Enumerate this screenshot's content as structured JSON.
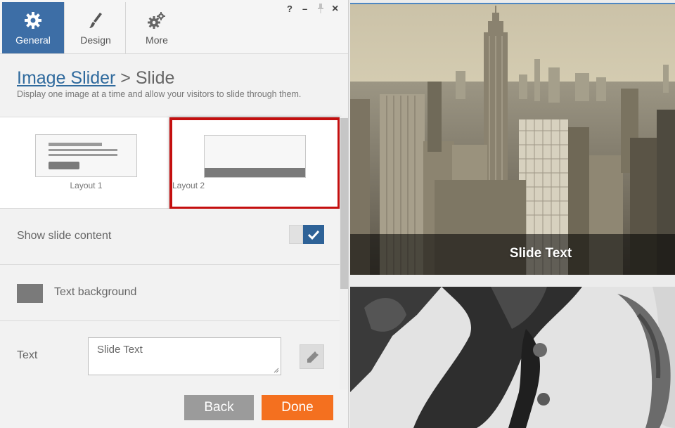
{
  "tabs": [
    {
      "label": "General",
      "icon": "gear-icon",
      "active": true
    },
    {
      "label": "Design",
      "icon": "paintbrush-icon",
      "active": false
    },
    {
      "label": "More",
      "icon": "gears-icon",
      "active": false
    }
  ],
  "window_controls": {
    "help": "?",
    "minimize": "–",
    "pin": "pin-icon",
    "close": "×"
  },
  "header": {
    "breadcrumb_link": "Image Slider",
    "breadcrumb_sep": " > ",
    "breadcrumb_current": "Slide",
    "description": "Display one image at a time and allow your visitors to slide through them."
  },
  "layouts": [
    {
      "label": "Layout 1",
      "selected": false
    },
    {
      "label": "Layout 2",
      "selected": true
    }
  ],
  "settings": {
    "show_slide_content_label": "Show slide content",
    "show_slide_content_checked": true,
    "text_background_label": "Text background",
    "text_background_color": "#7a7a7a",
    "text_label": "Text",
    "text_value": "Slide Text"
  },
  "buttons": {
    "back": "Back",
    "done": "Done"
  },
  "preview": {
    "slide_caption": "Slide Text"
  },
  "colors": {
    "accent": "#3d6ea6",
    "highlight": "#c40f0f",
    "done": "#f4701f",
    "back": "#9b9b9b"
  }
}
